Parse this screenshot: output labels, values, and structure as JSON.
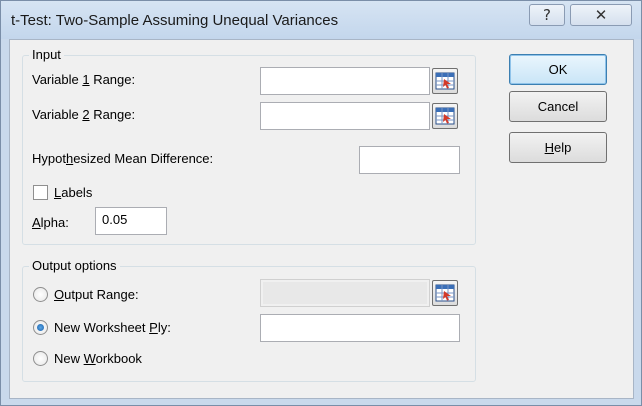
{
  "window": {
    "title": "t-Test: Two-Sample Assuming Unequal Variances",
    "help_glyph": "?",
    "close_glyph": "✕"
  },
  "input_group": {
    "label": "Input",
    "var1": {
      "pre": "Variable ",
      "ul": "1",
      "post": " Range:",
      "value": ""
    },
    "var2": {
      "pre": "Variable ",
      "ul": "2",
      "post": " Range:",
      "value": ""
    },
    "hyp": {
      "pre": "Hypot",
      "ul": "h",
      "post": "esized Mean Difference:",
      "value": ""
    },
    "labels": {
      "ul": "L",
      "post": "abels",
      "checked": false
    },
    "alpha": {
      "ul": "A",
      "post": "lpha:",
      "value": "0.05"
    }
  },
  "output_group": {
    "label": "Output options",
    "output_range": {
      "ul": "O",
      "post": "utput Range:",
      "selected": false,
      "value": ""
    },
    "new_ply": {
      "pre": "New Worksheet ",
      "ul": "P",
      "post": "ly:",
      "selected": true,
      "value": ""
    },
    "new_workbook": {
      "pre": "New ",
      "ul": "W",
      "post": "orkbook",
      "selected": false
    }
  },
  "buttons": {
    "ok": "OK",
    "cancel": "Cancel",
    "help": {
      "ul": "H",
      "post": "elp"
    }
  },
  "icons": [
    "range-select-icon",
    "help-icon",
    "close-icon"
  ]
}
